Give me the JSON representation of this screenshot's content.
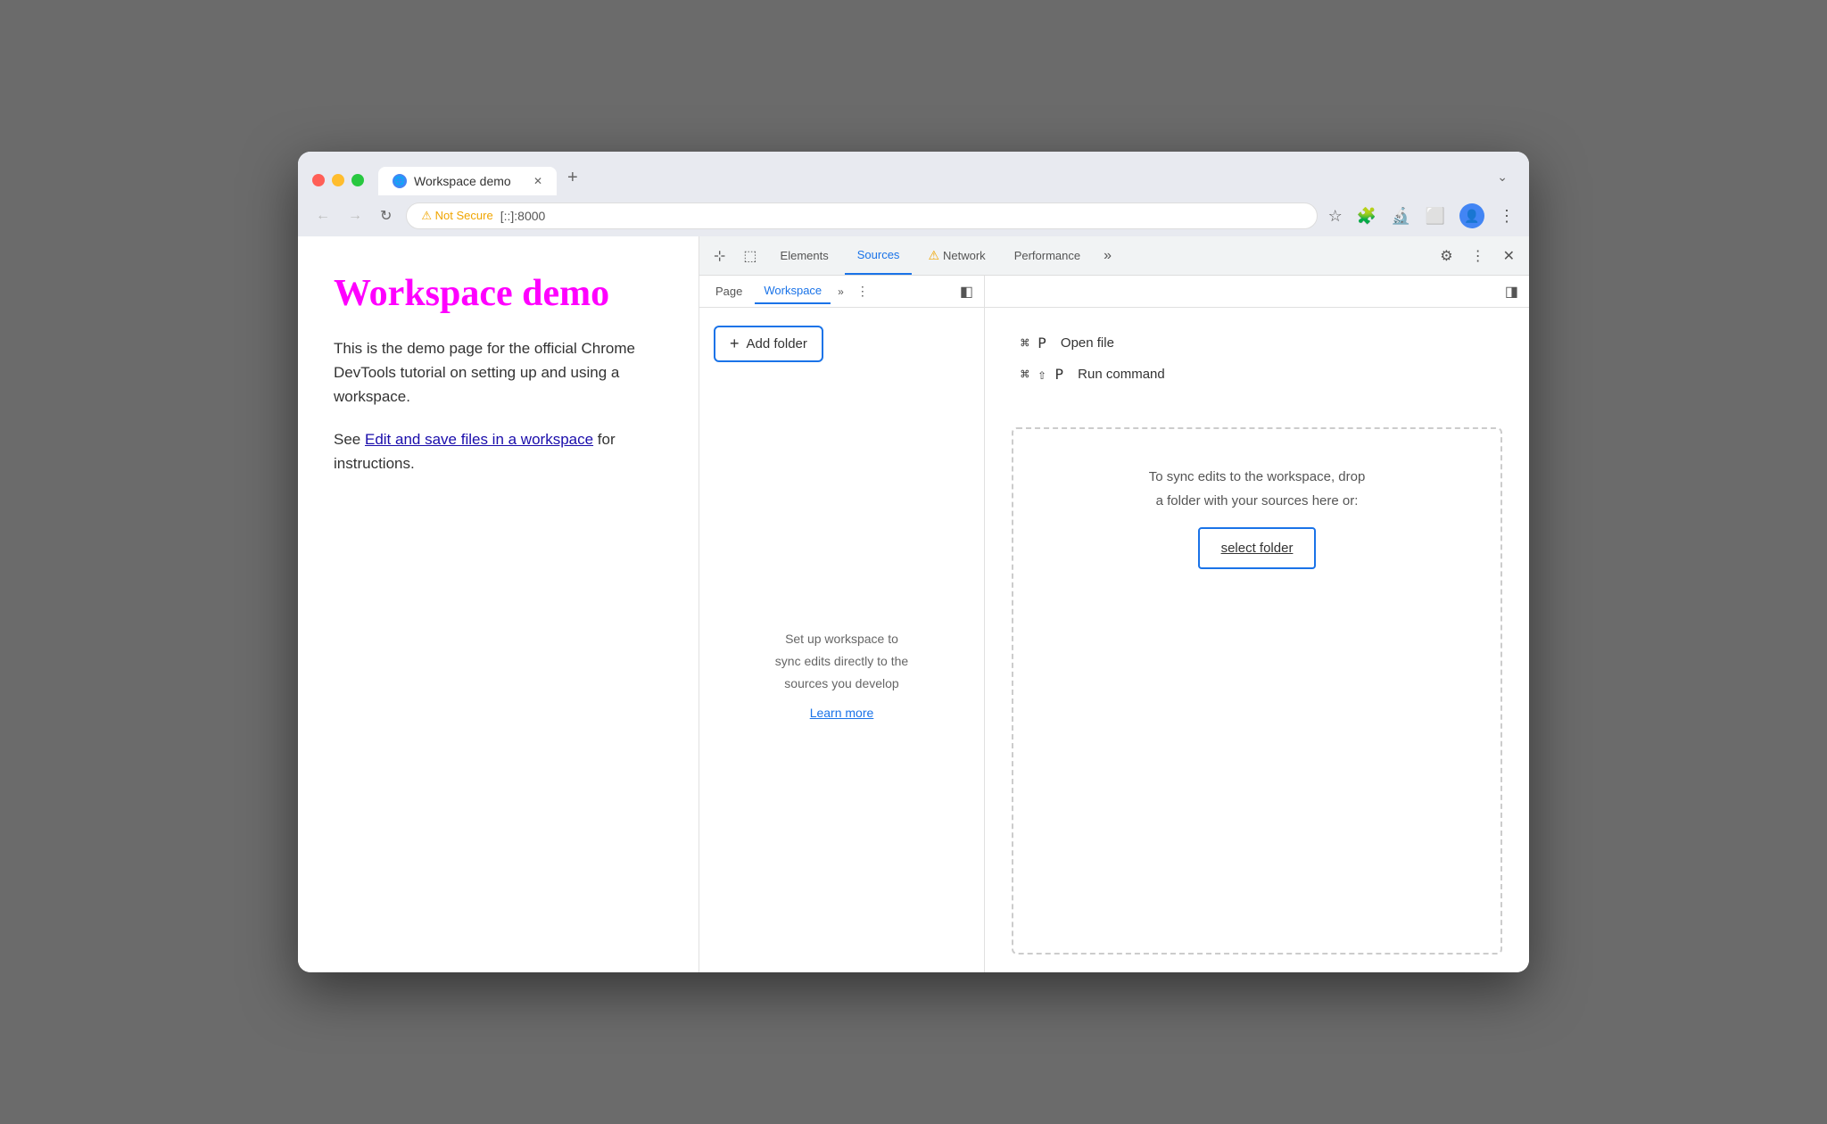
{
  "browser": {
    "traffic_lights": [
      "red",
      "yellow",
      "green"
    ],
    "tab": {
      "title": "Workspace demo",
      "close_label": "✕",
      "new_tab_label": "+"
    },
    "expand_label": "⌄",
    "nav": {
      "back_label": "←",
      "forward_label": "→",
      "refresh_label": "↻"
    },
    "url_bar": {
      "warning": "⚠ Not Secure",
      "address": "[::]:8000"
    },
    "actions": {
      "bookmark": "☆",
      "extensions": "🧩",
      "devtools": "🔬",
      "split": "⬜",
      "user": "👤",
      "menu": "⋮"
    }
  },
  "page": {
    "title": "Workspace demo",
    "body1": "This is the demo page for the official Chrome DevTools tutorial on setting up and using a workspace.",
    "body2_prefix": "See ",
    "link_text": "Edit and save files in a workspace",
    "body2_suffix": " for instructions."
  },
  "devtools": {
    "toolbar": {
      "cursor_icon": "⊹",
      "device_icon": "⬚",
      "tabs": [
        {
          "label": "Elements",
          "active": false
        },
        {
          "label": "Sources",
          "active": true
        },
        {
          "label": "Network",
          "active": false,
          "warning": true
        },
        {
          "label": "Performance",
          "active": false
        }
      ],
      "more_label": "»",
      "settings_icon": "⚙",
      "menu_icon": "⋮",
      "close_icon": "✕"
    },
    "sources": {
      "tabs": [
        {
          "label": "Page",
          "active": false
        },
        {
          "label": "Workspace",
          "active": true
        }
      ],
      "more_label": "»",
      "menu_icon": "⋮",
      "sidebar_toggle": "◧",
      "add_folder_label": "Add folder",
      "workspace_info": {
        "line1": "Set up workspace to",
        "line2": "sync edits directly to the",
        "line3": "sources you develop",
        "learn_more": "Learn more"
      }
    },
    "editor": {
      "sidebar_toggle_right": "◨",
      "shortcuts": [
        {
          "key": "⌘ P",
          "label": "Open file"
        },
        {
          "key": "⌘ ⇧ P",
          "label": "Run command"
        }
      ],
      "drop_zone": {
        "line1": "To sync edits to the workspace, drop",
        "line2": "a folder with your sources here or:",
        "select_folder": "select folder"
      }
    }
  }
}
